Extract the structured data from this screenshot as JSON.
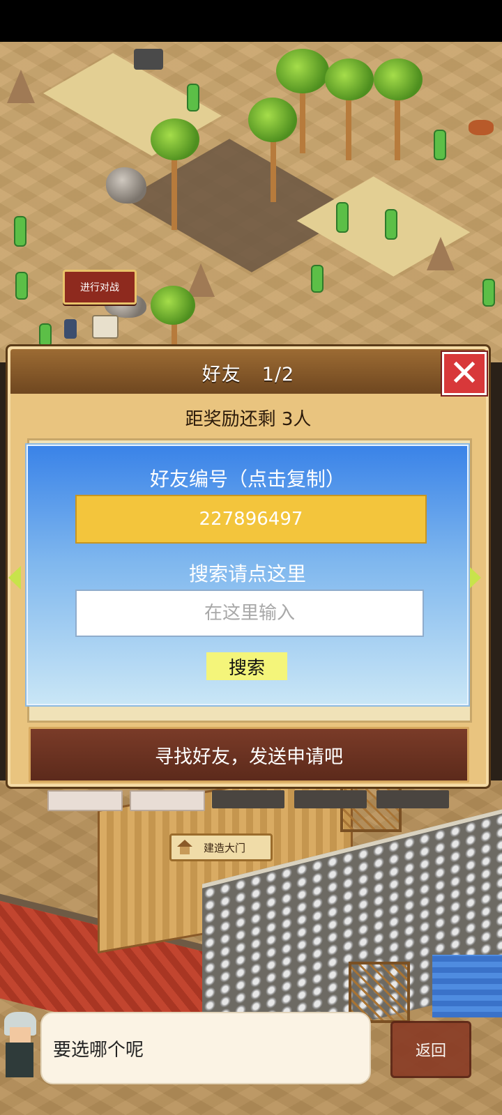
{
  "map": {
    "battle_sign": "进行对战",
    "gate_sign": "建造大门"
  },
  "dialog": {
    "title": "好友",
    "page": "1/2",
    "reward_text": "距奖励还剩 3人",
    "friend_id_title": "好友编号（点击复制）",
    "friend_id": "227896497",
    "search_label": "搜索请点这里",
    "search_placeholder": "在这里输入",
    "search_button": "搜索",
    "find_friends_button": "寻找好友，发送申请吧"
  },
  "footer": {
    "speech": "要选哪个呢",
    "back_button": "返回"
  },
  "icons": [
    "close-icon",
    "arrow-left-icon",
    "arrow-right-icon",
    "home-icon"
  ],
  "colors": {
    "id_box": "#f3c53c",
    "search_button": "#f4f57a",
    "close_button": "#d8383a",
    "panel_blue": "#3a83e8"
  }
}
